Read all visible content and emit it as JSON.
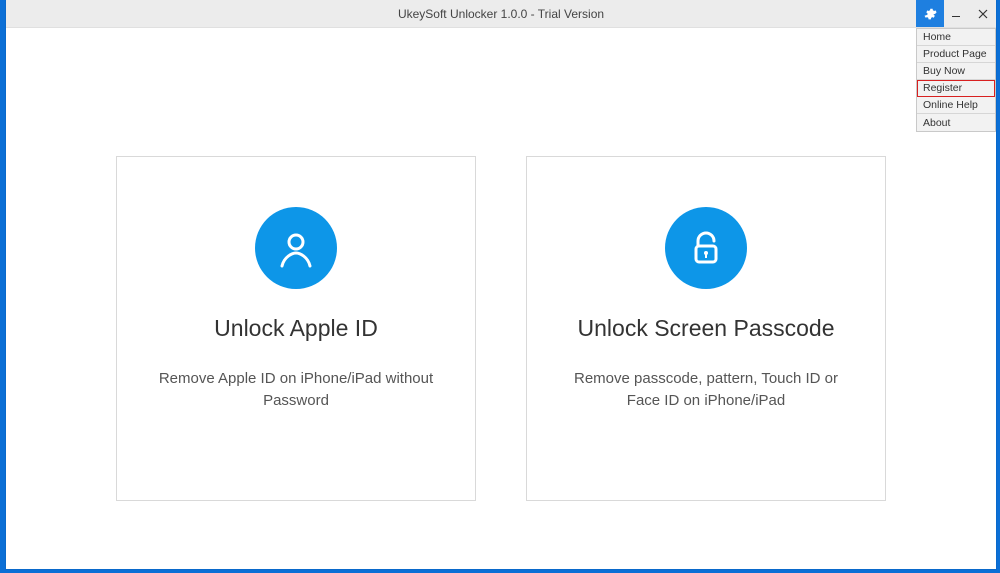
{
  "titlebar": {
    "title": "UkeySoft Unlocker 1.0.0 - Trial Version"
  },
  "menu": {
    "items": [
      {
        "label": "Home",
        "highlight": false
      },
      {
        "label": "Product Page",
        "highlight": false
      },
      {
        "label": "Buy Now",
        "highlight": false
      },
      {
        "label": "Register",
        "highlight": true
      },
      {
        "label": "Online Help",
        "highlight": false
      },
      {
        "label": "About",
        "highlight": false
      }
    ]
  },
  "cards": {
    "apple_id": {
      "title": "Unlock Apple ID",
      "desc": "Remove Apple ID on iPhone/iPad without Password"
    },
    "screen_passcode": {
      "title": "Unlock Screen Passcode",
      "desc": "Remove passcode, pattern, Touch ID or Face ID on iPhone/iPad"
    }
  },
  "colors": {
    "accent": "#0d96e8",
    "highlight_border": "#d82020"
  }
}
